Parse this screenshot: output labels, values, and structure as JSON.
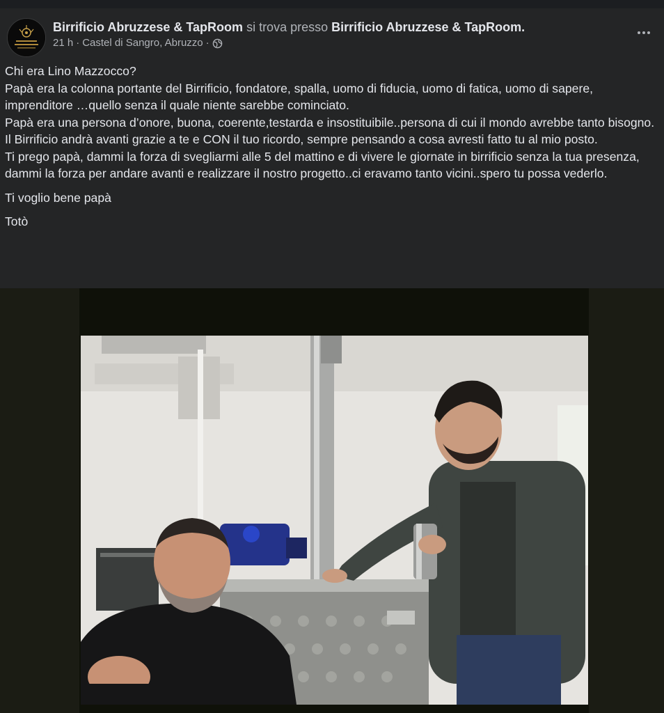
{
  "post": {
    "page_name": "Birrificio Abruzzese & TapRoom",
    "location_phrase": "si trova presso",
    "location_name": "Birrificio Abruzzese & TapRoom.",
    "time": "21 h",
    "separator": "·",
    "place": "Castel di Sangro, Abruzzo",
    "privacy_icon": "globe-icon",
    "more_icon": "more-horizontal-icon",
    "paragraphs": [
      "Chi era Lino Mazzocco?",
      "Papà era la colonna portante del Birrificio, fondatore, spalla, uomo di fiducia, uomo di fatica, uomo di sapere, imprenditore …quello senza il quale niente sarebbe cominciato.",
      "Papà era una persona d’onore, buona, coerente,testarda e insostituibile..persona di cui il mondo avrebbe tanto bisogno.",
      "Il Birrificio andrà avanti grazie a te e CON il tuo ricordo, sempre pensando a cosa avresti fatto tu al mio posto.",
      "Ti prego papà, dammi la forza di svegliarmi alle 5 del mattino e di vivere le giornate in birrificio senza la tua presenza, dammi la forza per andare avanti e realizzare il nostro progetto..ci eravamo tanto vicini..spero tu possa vederlo.",
      "Ti voglio bene papà",
      "Totò"
    ]
  },
  "colors": {
    "background": "#18191a",
    "card": "#242526",
    "primary_text": "#e4e6eb",
    "secondary_text": "#b0b3b8"
  }
}
